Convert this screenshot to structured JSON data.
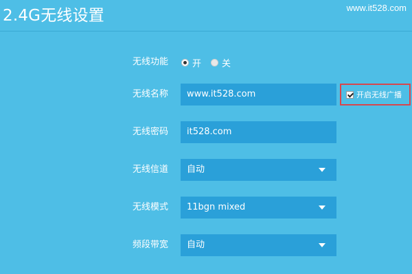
{
  "header": {
    "title": "2.4G无线设置",
    "watermark": "www.it528.com"
  },
  "form": {
    "wireless_function": {
      "label": "无线功能",
      "options": [
        "开",
        "关"
      ],
      "selected": "开"
    },
    "ssid": {
      "label": "无线名称",
      "value": "www.it528.com"
    },
    "broadcast": {
      "label": "开启无线广播",
      "checked": true
    },
    "password": {
      "label": "无线密码",
      "value": "it528.com"
    },
    "channel": {
      "label": "无线信道",
      "value": "自动"
    },
    "mode": {
      "label": "无线模式",
      "value": "11bgn mixed"
    },
    "bandwidth": {
      "label": "频段带宽",
      "value": "自动"
    }
  },
  "colors": {
    "background": "#4ebee6",
    "field": "#2aa0d9",
    "highlight": "#d9454b"
  }
}
